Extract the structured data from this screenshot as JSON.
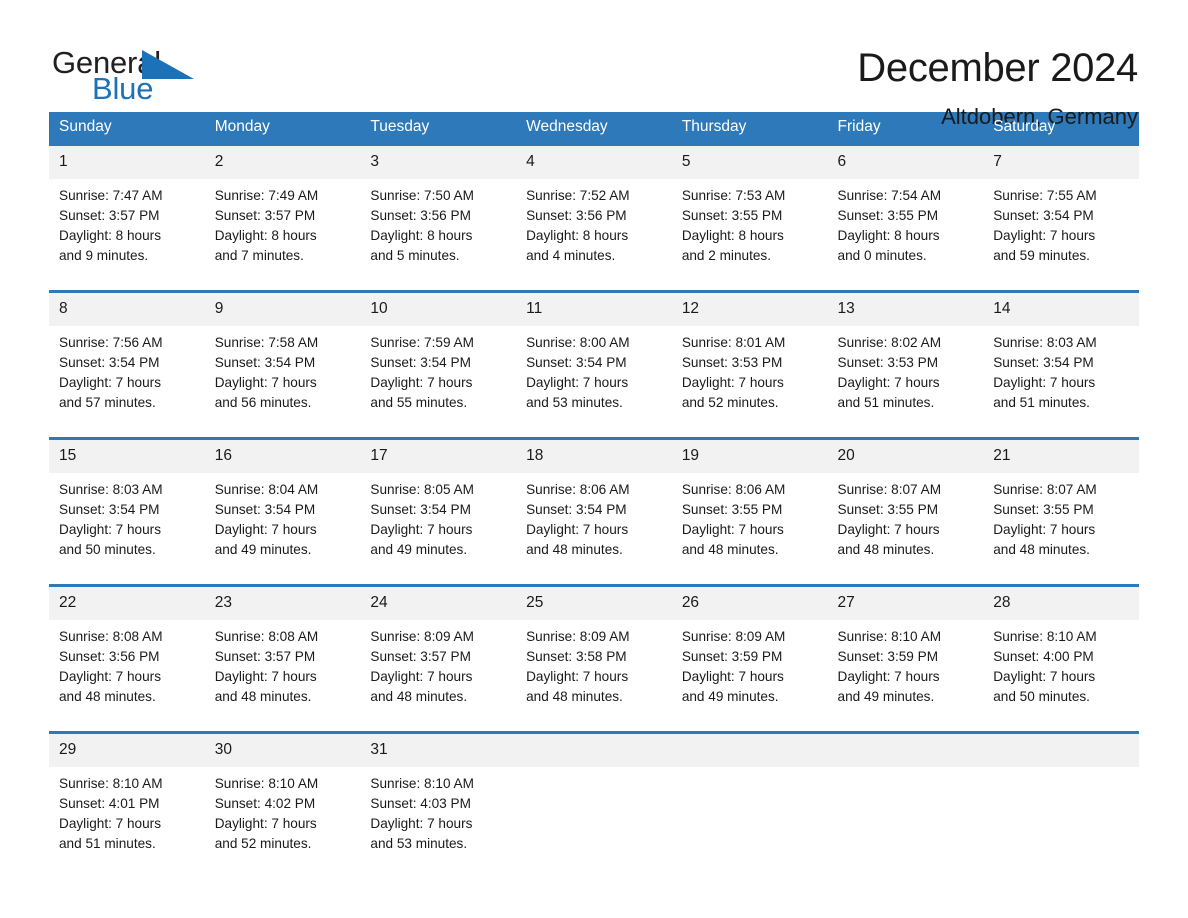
{
  "logo": {
    "word_top": "General",
    "word_bottom": "Blue",
    "mark": "triangle-icon",
    "accent_color": "#1b72b8"
  },
  "header": {
    "title": "December 2024",
    "location": "Altdobern, Germany"
  },
  "colors": {
    "header_blue": "#2e79b9",
    "row_rule_blue": "#2e79b9",
    "daynum_band": "#f2f2f2",
    "text": "#1a1a1a"
  },
  "calendar": {
    "weekday_headers": [
      "Sunday",
      "Monday",
      "Tuesday",
      "Wednesday",
      "Thursday",
      "Friday",
      "Saturday"
    ],
    "weeks": [
      [
        {
          "day": "1",
          "sunrise": "Sunrise: 7:47 AM",
          "sunset": "Sunset: 3:57 PM",
          "daylight_line1": "Daylight: 8 hours",
          "daylight_line2": "and 9 minutes."
        },
        {
          "day": "2",
          "sunrise": "Sunrise: 7:49 AM",
          "sunset": "Sunset: 3:57 PM",
          "daylight_line1": "Daylight: 8 hours",
          "daylight_line2": "and 7 minutes."
        },
        {
          "day": "3",
          "sunrise": "Sunrise: 7:50 AM",
          "sunset": "Sunset: 3:56 PM",
          "daylight_line1": "Daylight: 8 hours",
          "daylight_line2": "and 5 minutes."
        },
        {
          "day": "4",
          "sunrise": "Sunrise: 7:52 AM",
          "sunset": "Sunset: 3:56 PM",
          "daylight_line1": "Daylight: 8 hours",
          "daylight_line2": "and 4 minutes."
        },
        {
          "day": "5",
          "sunrise": "Sunrise: 7:53 AM",
          "sunset": "Sunset: 3:55 PM",
          "daylight_line1": "Daylight: 8 hours",
          "daylight_line2": "and 2 minutes."
        },
        {
          "day": "6",
          "sunrise": "Sunrise: 7:54 AM",
          "sunset": "Sunset: 3:55 PM",
          "daylight_line1": "Daylight: 8 hours",
          "daylight_line2": "and 0 minutes."
        },
        {
          "day": "7",
          "sunrise": "Sunrise: 7:55 AM",
          "sunset": "Sunset: 3:54 PM",
          "daylight_line1": "Daylight: 7 hours",
          "daylight_line2": "and 59 minutes."
        }
      ],
      [
        {
          "day": "8",
          "sunrise": "Sunrise: 7:56 AM",
          "sunset": "Sunset: 3:54 PM",
          "daylight_line1": "Daylight: 7 hours",
          "daylight_line2": "and 57 minutes."
        },
        {
          "day": "9",
          "sunrise": "Sunrise: 7:58 AM",
          "sunset": "Sunset: 3:54 PM",
          "daylight_line1": "Daylight: 7 hours",
          "daylight_line2": "and 56 minutes."
        },
        {
          "day": "10",
          "sunrise": "Sunrise: 7:59 AM",
          "sunset": "Sunset: 3:54 PM",
          "daylight_line1": "Daylight: 7 hours",
          "daylight_line2": "and 55 minutes."
        },
        {
          "day": "11",
          "sunrise": "Sunrise: 8:00 AM",
          "sunset": "Sunset: 3:54 PM",
          "daylight_line1": "Daylight: 7 hours",
          "daylight_line2": "and 53 minutes."
        },
        {
          "day": "12",
          "sunrise": "Sunrise: 8:01 AM",
          "sunset": "Sunset: 3:53 PM",
          "daylight_line1": "Daylight: 7 hours",
          "daylight_line2": "and 52 minutes."
        },
        {
          "day": "13",
          "sunrise": "Sunrise: 8:02 AM",
          "sunset": "Sunset: 3:53 PM",
          "daylight_line1": "Daylight: 7 hours",
          "daylight_line2": "and 51 minutes."
        },
        {
          "day": "14",
          "sunrise": "Sunrise: 8:03 AM",
          "sunset": "Sunset: 3:54 PM",
          "daylight_line1": "Daylight: 7 hours",
          "daylight_line2": "and 51 minutes."
        }
      ],
      [
        {
          "day": "15",
          "sunrise": "Sunrise: 8:03 AM",
          "sunset": "Sunset: 3:54 PM",
          "daylight_line1": "Daylight: 7 hours",
          "daylight_line2": "and 50 minutes."
        },
        {
          "day": "16",
          "sunrise": "Sunrise: 8:04 AM",
          "sunset": "Sunset: 3:54 PM",
          "daylight_line1": "Daylight: 7 hours",
          "daylight_line2": "and 49 minutes."
        },
        {
          "day": "17",
          "sunrise": "Sunrise: 8:05 AM",
          "sunset": "Sunset: 3:54 PM",
          "daylight_line1": "Daylight: 7 hours",
          "daylight_line2": "and 49 minutes."
        },
        {
          "day": "18",
          "sunrise": "Sunrise: 8:06 AM",
          "sunset": "Sunset: 3:54 PM",
          "daylight_line1": "Daylight: 7 hours",
          "daylight_line2": "and 48 minutes."
        },
        {
          "day": "19",
          "sunrise": "Sunrise: 8:06 AM",
          "sunset": "Sunset: 3:55 PM",
          "daylight_line1": "Daylight: 7 hours",
          "daylight_line2": "and 48 minutes."
        },
        {
          "day": "20",
          "sunrise": "Sunrise: 8:07 AM",
          "sunset": "Sunset: 3:55 PM",
          "daylight_line1": "Daylight: 7 hours",
          "daylight_line2": "and 48 minutes."
        },
        {
          "day": "21",
          "sunrise": "Sunrise: 8:07 AM",
          "sunset": "Sunset: 3:55 PM",
          "daylight_line1": "Daylight: 7 hours",
          "daylight_line2": "and 48 minutes."
        }
      ],
      [
        {
          "day": "22",
          "sunrise": "Sunrise: 8:08 AM",
          "sunset": "Sunset: 3:56 PM",
          "daylight_line1": "Daylight: 7 hours",
          "daylight_line2": "and 48 minutes."
        },
        {
          "day": "23",
          "sunrise": "Sunrise: 8:08 AM",
          "sunset": "Sunset: 3:57 PM",
          "daylight_line1": "Daylight: 7 hours",
          "daylight_line2": "and 48 minutes."
        },
        {
          "day": "24",
          "sunrise": "Sunrise: 8:09 AM",
          "sunset": "Sunset: 3:57 PM",
          "daylight_line1": "Daylight: 7 hours",
          "daylight_line2": "and 48 minutes."
        },
        {
          "day": "25",
          "sunrise": "Sunrise: 8:09 AM",
          "sunset": "Sunset: 3:58 PM",
          "daylight_line1": "Daylight: 7 hours",
          "daylight_line2": "and 48 minutes."
        },
        {
          "day": "26",
          "sunrise": "Sunrise: 8:09 AM",
          "sunset": "Sunset: 3:59 PM",
          "daylight_line1": "Daylight: 7 hours",
          "daylight_line2": "and 49 minutes."
        },
        {
          "day": "27",
          "sunrise": "Sunrise: 8:10 AM",
          "sunset": "Sunset: 3:59 PM",
          "daylight_line1": "Daylight: 7 hours",
          "daylight_line2": "and 49 minutes."
        },
        {
          "day": "28",
          "sunrise": "Sunrise: 8:10 AM",
          "sunset": "Sunset: 4:00 PM",
          "daylight_line1": "Daylight: 7 hours",
          "daylight_line2": "and 50 minutes."
        }
      ],
      [
        {
          "day": "29",
          "sunrise": "Sunrise: 8:10 AM",
          "sunset": "Sunset: 4:01 PM",
          "daylight_line1": "Daylight: 7 hours",
          "daylight_line2": "and 51 minutes."
        },
        {
          "day": "30",
          "sunrise": "Sunrise: 8:10 AM",
          "sunset": "Sunset: 4:02 PM",
          "daylight_line1": "Daylight: 7 hours",
          "daylight_line2": "and 52 minutes."
        },
        {
          "day": "31",
          "sunrise": "Sunrise: 8:10 AM",
          "sunset": "Sunset: 4:03 PM",
          "daylight_line1": "Daylight: 7 hours",
          "daylight_line2": "and 53 minutes."
        },
        {
          "day": "",
          "sunrise": "",
          "sunset": "",
          "daylight_line1": "",
          "daylight_line2": ""
        },
        {
          "day": "",
          "sunrise": "",
          "sunset": "",
          "daylight_line1": "",
          "daylight_line2": ""
        },
        {
          "day": "",
          "sunrise": "",
          "sunset": "",
          "daylight_line1": "",
          "daylight_line2": ""
        },
        {
          "day": "",
          "sunrise": "",
          "sunset": "",
          "daylight_line1": "",
          "daylight_line2": ""
        }
      ]
    ]
  }
}
